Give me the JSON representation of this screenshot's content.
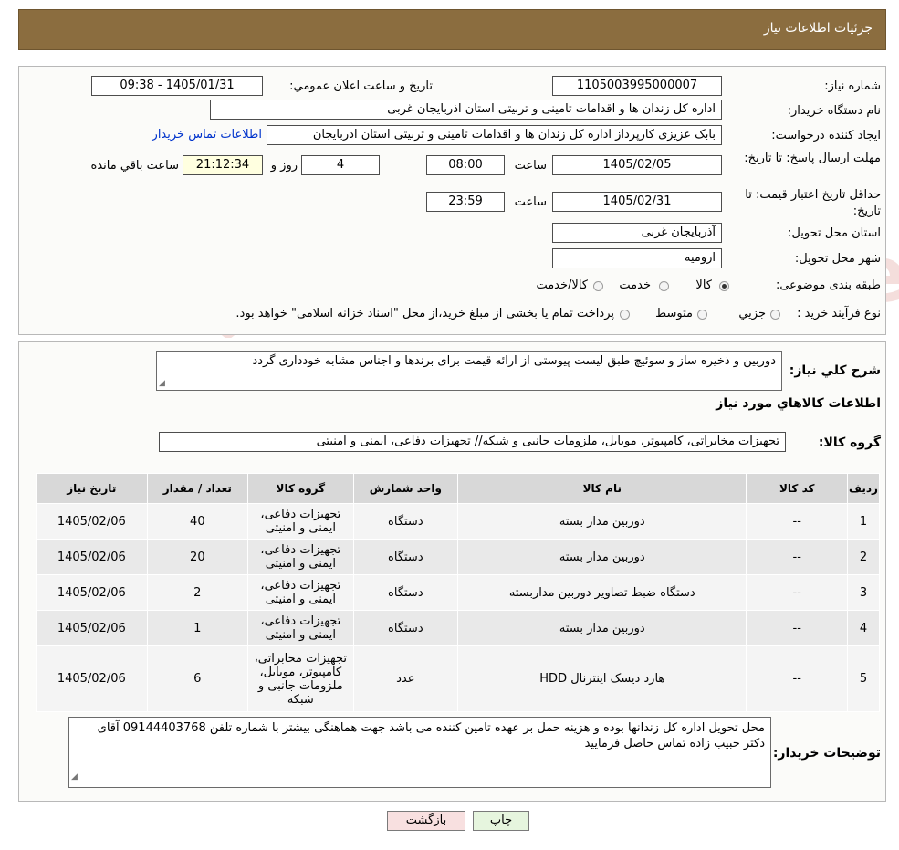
{
  "header": {
    "title": "جزئیات اطلاعات نیاز"
  },
  "form": {
    "need_number_label": "شماره نیاز:",
    "need_number": "1105003995000007",
    "announce_label": "تاریخ و ساعت اعلان عمومي:",
    "announce_value": "1405/01/31 - 09:38",
    "buyer_org_label": "نام دستگاه خريدار:",
    "buyer_org": "اداره کل زندان ها و اقدامات تامینی و تربیتی استان اذربایجان غربی",
    "creator_label": "ایجاد کننده درخواست:",
    "creator": "بابک عزیزی کارپرداز اداره کل زندان ها و اقدامات تامینی و تربیتی استان اذربایجان",
    "contact_link": "اطلاعات تماس خريدار",
    "reply_deadline_label": "مهلت ارسال پاسخ: تا تاریخ:",
    "reply_date": "1405/02/05",
    "time_label": "ساعت",
    "reply_time": "08:00",
    "days_count": "4",
    "days_label": "روز و",
    "remaining_time": "21:12:34",
    "remaining_label": "ساعت باقي مانده",
    "price_validity_label": "حداقل تاريخ اعتبار قيمت: تا تاریخ:",
    "validity_date": "1405/02/31",
    "validity_time": "23:59",
    "province_label": "استان محل تحویل:",
    "province": "آذربایجان غربی",
    "city_label": "شهر محل تحویل:",
    "city": "ارومیه",
    "category_label": "طبقه بندی موضوعی:",
    "category_options": [
      "کالا",
      "خدمت",
      "کالا/خدمت"
    ],
    "process_label": "نوع فرآيند خريد :",
    "process_options": [
      "جزيي",
      "متوسط"
    ],
    "process_note": "پرداخت تمام یا بخشی از مبلغ خرید،از محل \"اسناد خزانه اسلامی\" خواهد بود."
  },
  "description": {
    "label": "شرح كلي نياز:",
    "text": "دوربین و ذخیره ساز  و سوئیچ طبق لیست پیوستی از ارائه قیمت برای برندها و اجناس مشابه خودداری گردد"
  },
  "goods": {
    "section_title": "اطلاعات كالاهاي مورد نياز",
    "group_label": "گروه كالا:",
    "group_value": "تجهیزات مخابراتی، کامپیوتر، موبایل، ملزومات جانبی و شبکه// تجهیزات دفاعی، ایمنی و امنیتی",
    "columns": [
      "رديف",
      "كد كالا",
      "نام كالا",
      "واحد شمارش",
      "گروه كالا",
      "تعداد / مقدار",
      "تاريخ نياز"
    ],
    "rows": [
      [
        "1",
        "--",
        "دوربین مدار بسته",
        "دستگاه",
        "تجهیزات دفاعی، ایمنی و امنیتی",
        "40",
        "1405/02/06"
      ],
      [
        "2",
        "--",
        "دوربین مدار بسته",
        "دستگاه",
        "تجهیزات دفاعی، ایمنی و امنیتی",
        "20",
        "1405/02/06"
      ],
      [
        "3",
        "--",
        "دستگاه ضبط تصاویر دوربین مداربسته",
        "دستگاه",
        "تجهیزات دفاعی، ایمنی و امنیتی",
        "2",
        "1405/02/06"
      ],
      [
        "4",
        "--",
        "دوربین مدار بسته",
        "دستگاه",
        "تجهیزات دفاعی، ایمنی و امنیتی",
        "1",
        "1405/02/06"
      ],
      [
        "5",
        "--",
        "هارد دیسک اینترنال HDD",
        "عدد",
        "تجهیزات مخابراتی، کامپیوتر، موبایل، ملزومات جانبی و شبکه",
        "6",
        "1405/02/06"
      ]
    ]
  },
  "buyer_notes": {
    "label": "توضیحات خریدار:",
    "text": "محل تحویل اداره کل زندانها بوده  و هزینه حمل  بر عهده تامین کننده می باشد جهت هماهنگی بیشتر با شماره تلفن 09144403768 آقای دکتر حبیب زاده تماس حاصل فرمایید"
  },
  "buttons": {
    "print": "چاپ",
    "back": "بازگشت"
  },
  "watermark": "AriaTender.neT",
  "colors": {
    "header_bg": "#8b6d3f",
    "back_button_bg": "#f8e0e0",
    "print_button_bg": "#e6f5de",
    "link": "#0033cc"
  }
}
